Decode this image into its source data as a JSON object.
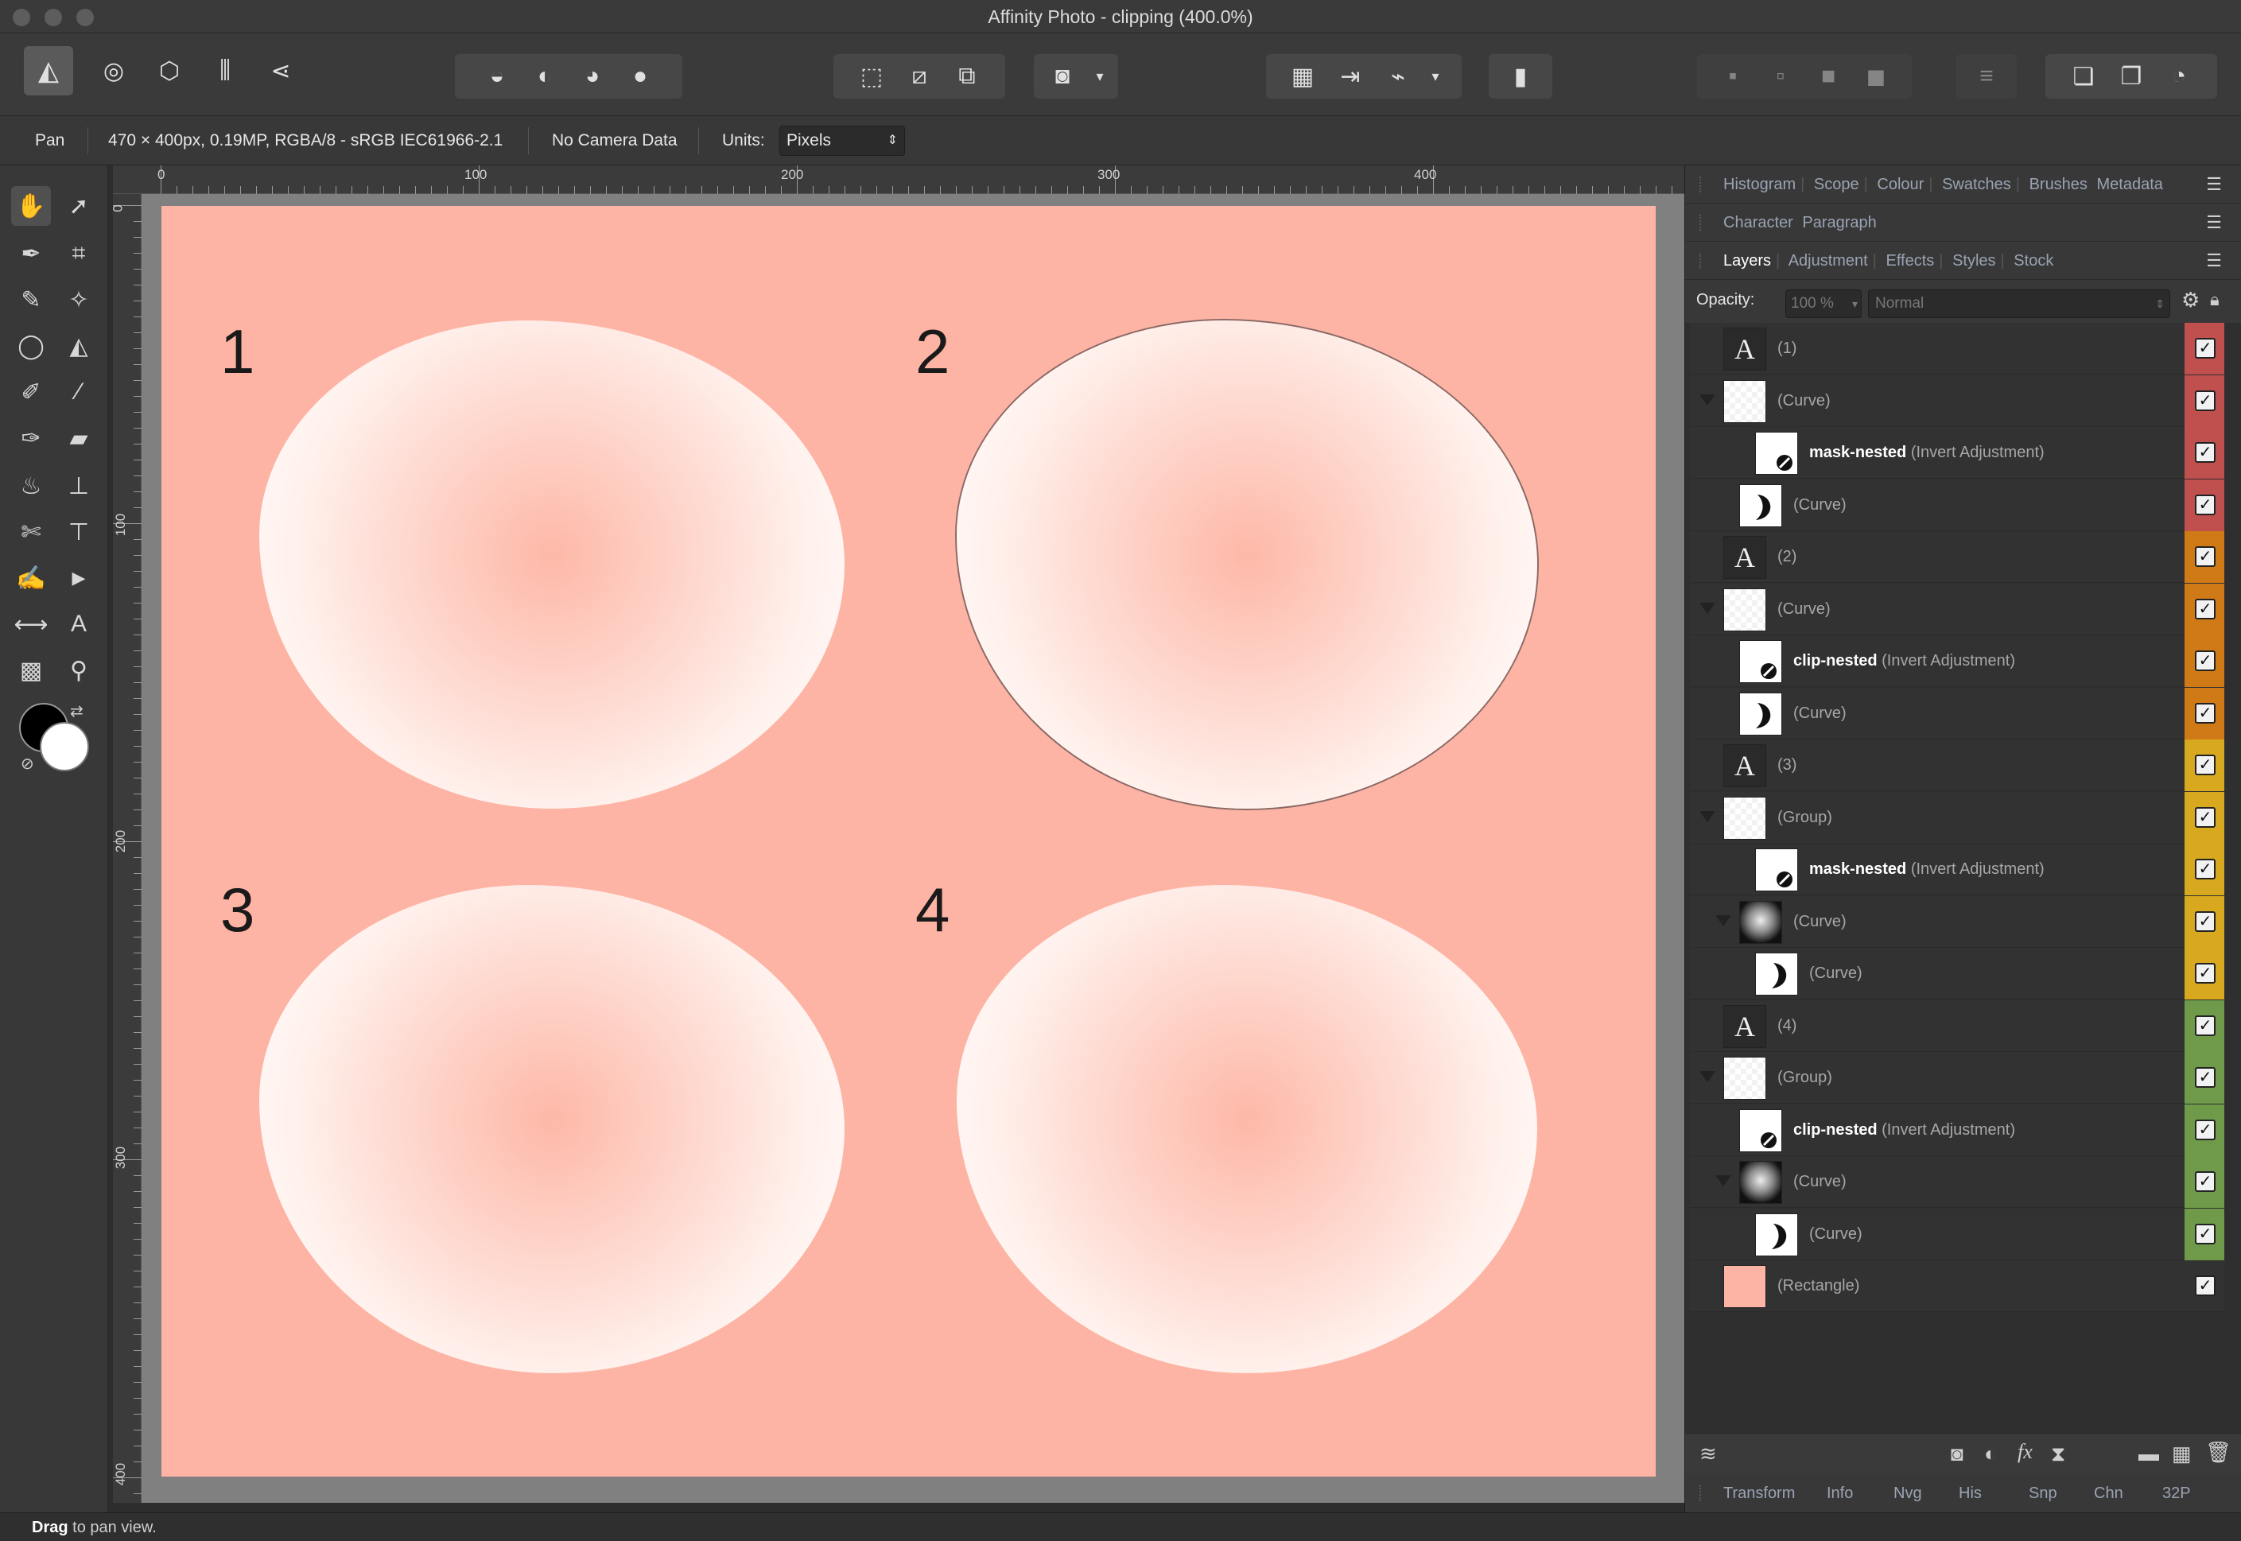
{
  "window": {
    "title": "Affinity Photo - clipping (400.0%)"
  },
  "context": {
    "tool": "Pan",
    "doc_info": "470 × 400px, 0.19MP, RGBA/8 - sRGB IEC61966-2.1",
    "camera": "No Camera Data",
    "units_label": "Units:",
    "units_value": "Pixels"
  },
  "ruler": {
    "unit": "px",
    "h_ticks": [
      "0",
      "100",
      "200",
      "300",
      "400"
    ],
    "v_ticks": [
      "0",
      "100",
      "200",
      "300",
      "400"
    ]
  },
  "canvas": {
    "labels": [
      "1",
      "2",
      "3",
      "4"
    ],
    "bg_color": "#feb4a4"
  },
  "panel": {
    "tabs_row1": [
      "Histogram",
      "Scope",
      "Colour",
      "Swatches",
      "Brushes",
      "Metadata"
    ],
    "tabs_row2": [
      "Character",
      "Paragraph"
    ],
    "tabs_row3": [
      "Layers",
      "Adjustment",
      "Effects",
      "Styles",
      "Stock"
    ],
    "opacity_label": "Opacity:",
    "opacity_value": "100 %",
    "blend_mode": "Normal",
    "layers": [
      {
        "name": "",
        "type": "(1)",
        "thumb": "text",
        "color": "#c0504d",
        "indent": 0,
        "expand": false
      },
      {
        "name": "",
        "type": "(Curve)",
        "thumb": "checker",
        "color": "#c0504d",
        "indent": 0,
        "expand": true
      },
      {
        "name": "mask-nested",
        "type": " (Invert Adjustment)",
        "thumb": "adjust",
        "color": "#c0504d",
        "indent": 2,
        "expand": false
      },
      {
        "name": "",
        "type": "(Curve)",
        "thumb": "crescent",
        "color": "#c0504d",
        "indent": 1,
        "expand": false
      },
      {
        "name": "",
        "type": "(2)",
        "thumb": "text",
        "color": "#d07a17",
        "indent": 0,
        "expand": false
      },
      {
        "name": "",
        "type": "(Curve)",
        "thumb": "checker",
        "color": "#d07a17",
        "indent": 0,
        "expand": true
      },
      {
        "name": "clip-nested",
        "type": " (Invert Adjustment)",
        "thumb": "adjust",
        "color": "#d07a17",
        "indent": 1,
        "expand": false
      },
      {
        "name": "",
        "type": "(Curve)",
        "thumb": "crescent",
        "color": "#d07a17",
        "indent": 1,
        "expand": false
      },
      {
        "name": "",
        "type": "(3)",
        "thumb": "text",
        "color": "#d8a81e",
        "indent": 0,
        "expand": false
      },
      {
        "name": "",
        "type": "(Group)",
        "thumb": "checker",
        "color": "#d8a81e",
        "indent": 0,
        "expand": true
      },
      {
        "name": "mask-nested",
        "type": " (Invert Adjustment)",
        "thumb": "adjust",
        "color": "#d8a81e",
        "indent": 2,
        "expand": false
      },
      {
        "name": "",
        "type": "(Curve)",
        "thumb": "blob",
        "color": "#d8a81e",
        "indent": 1,
        "expand": true
      },
      {
        "name": "",
        "type": "(Curve)",
        "thumb": "crescent",
        "color": "#d8a81e",
        "indent": 2,
        "expand": false
      },
      {
        "name": "",
        "type": "(4)",
        "thumb": "text",
        "color": "#6f9a4a",
        "indent": 0,
        "expand": false
      },
      {
        "name": "",
        "type": "(Group)",
        "thumb": "checker",
        "color": "#6f9a4a",
        "indent": 0,
        "expand": true
      },
      {
        "name": "clip-nested",
        "type": " (Invert Adjustment)",
        "thumb": "adjust",
        "color": "#6f9a4a",
        "indent": 1,
        "expand": false
      },
      {
        "name": "",
        "type": "(Curve)",
        "thumb": "blob",
        "color": "#6f9a4a",
        "indent": 1,
        "expand": true
      },
      {
        "name": "",
        "type": "(Curve)",
        "thumb": "crescent",
        "color": "#6f9a4a",
        "indent": 2,
        "expand": false
      },
      {
        "name": "",
        "type": "(Rectangle)",
        "thumb": "rect",
        "color": "",
        "indent": 0,
        "expand": false
      }
    ],
    "bottom_tabs": [
      "Transform",
      "Info",
      "Nvg",
      "His",
      "Snp",
      "Chn",
      "32P"
    ]
  },
  "status": {
    "bold": "Drag",
    "rest": " to pan view."
  }
}
